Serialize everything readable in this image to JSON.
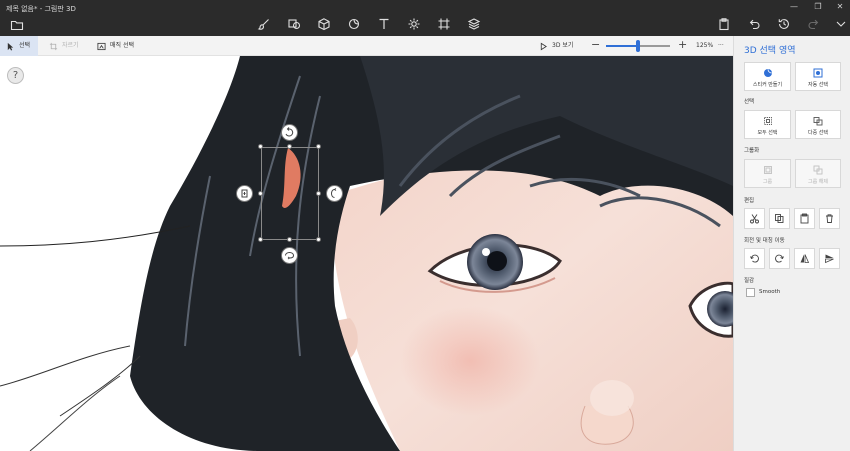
{
  "window": {
    "title": "제목 없음* - 그림판 3D",
    "controls": [
      "—",
      "❐",
      "✕"
    ]
  },
  "toolbar": {
    "tools": [
      "brushes-icon",
      "2d-shapes-icon",
      "3d-shapes-icon",
      "stickers-icon",
      "text-icon",
      "effects-icon",
      "canvas-icon",
      "3d-library-icon"
    ],
    "right": [
      "paste-icon",
      "undo-icon",
      "history-icon",
      "redo-icon",
      "expand-icon"
    ]
  },
  "commandbar": {
    "select_label": "선택",
    "crop_label": "자르기",
    "magic_select_label": "매직 선택",
    "view_3d_label": "3D 보기",
    "zoom_minus": "−",
    "zoom_plus": "+",
    "zoom_level": "125%",
    "zoom_fraction": 0.5,
    "more_label": "···"
  },
  "help_label": "?",
  "panel": {
    "title": "3D 선택 영역",
    "make_sticker_label": "스티커 만들기",
    "auto_select_label": "자동 선택",
    "select_section": "선택",
    "select_all_label": "모두 선택",
    "multi_select_label": "다중 선택",
    "group_section": "그룹화",
    "group_label": "그룹",
    "ungroup_label": "그룹 해제",
    "edit_section": "편집",
    "rotate_flip_section": "회전 및 대칭 이동",
    "texture_section": "질감",
    "smooth_label": "Smooth"
  },
  "colors": {
    "accent": "#2f6fd6",
    "titlebar": "#2b2b2b",
    "panel_bg": "#f0f0f0"
  }
}
